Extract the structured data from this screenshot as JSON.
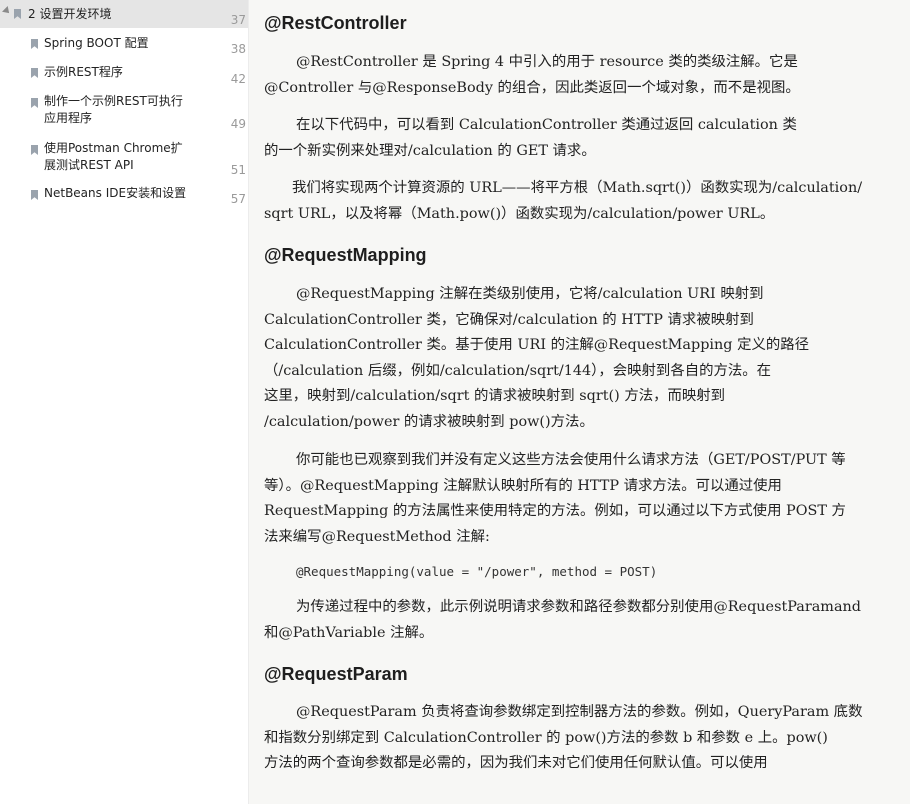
{
  "sidebar": {
    "items": [
      {
        "label": "2 设置开发环境",
        "page": "37"
      },
      {
        "label": "Spring BOOT 配置",
        "page": "38"
      },
      {
        "label": "示例REST程序",
        "page": "42"
      },
      {
        "label_line1": "制作一个示例REST可执行",
        "label_line2": "应用程序",
        "page": "49"
      },
      {
        "label_line1": "使用Postman Chrome扩",
        "label_line2": "展测试REST API",
        "page": "51"
      },
      {
        "label": "NetBeans IDE安装和设置",
        "page": "57"
      }
    ]
  },
  "doc": {
    "h1": "@RestController",
    "p1": [
      "@RestController 是 Spring 4 中引入的用于 resource 类的类级注解。它是",
      "@Controller 与@ResponseBody 的组合，因此类返回一个域对象，而不是视图。"
    ],
    "p2": [
      "在以下代码中，可以看到 CalculationController 类通过返回 calculation 类",
      "的一个新实例来处理对/calculation 的 GET 请求。"
    ],
    "p3": [
      "我们将实现两个计算资源的 URL——将平方根（Math.sqrt()）函数实现为/calculation/",
      "sqrt URL，以及将幂（Math.pow()）函数实现为/calculation/power URL。"
    ],
    "h2": "@RequestMapping",
    "p4": [
      "@RequestMapping 注解在类级别使用，它将/calculation URI 映射到",
      "CalculationController 类，它确保对/calculation 的 HTTP 请求被映射到",
      "CalculationController 类。基于使用 URI 的注解@RequestMapping 定义的路径",
      "（/calculation 后缀，例如/calculation/sqrt/144），会映射到各自的方法。在",
      "这里，映射到/calculation/sqrt 的请求被映射到 sqrt() 方法，而映射到",
      "/calculation/power 的请求被映射到 pow()方法。"
    ],
    "p5": [
      "你可能也已观察到我们并没有定义这些方法会使用什么请求方法（GET/POST/PUT 等",
      "等）。@RequestMapping 注解默认映射所有的 HTTP 请求方法。可以通过使用",
      "RequestMapping 的方法属性来使用特定的方法。例如，可以通过以下方式使用 POST 方",
      "法来编写@RequestMethod 注解:"
    ],
    "code": "@RequestMapping(value = \"/power\", method = POST)",
    "p6": [
      "为传递过程中的参数，此示例说明请求参数和路径参数都分别使用@RequestParamand",
      "和@PathVariable 注解。"
    ],
    "h3": "@RequestParam",
    "p7": [
      "@RequestParam 负责将查询参数绑定到控制器方法的参数。例如，QueryParam 底数",
      "和指数分别绑定到 CalculationController 的 pow()方法的参数 b 和参数 e 上。pow()",
      "方法的两个查询参数都是必需的，因为我们未对它们使用任何默认值。可以使用"
    ]
  }
}
